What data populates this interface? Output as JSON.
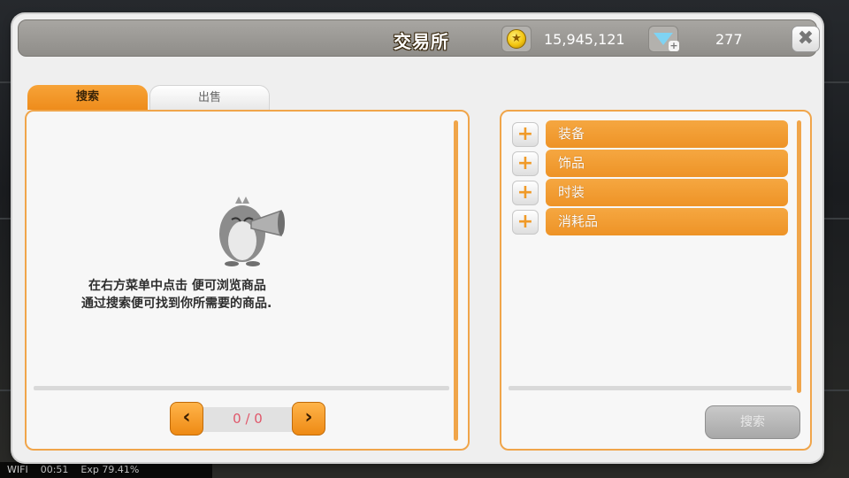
{
  "window": {
    "title": "交易所"
  },
  "currency": {
    "gold_icon": "gold-coin-icon",
    "gold_value": "15,945,121",
    "gem_icon": "gem-plus-icon",
    "gem_value": "277"
  },
  "close_icon": "close-icon",
  "tabs": [
    {
      "label": "搜索",
      "active": true
    },
    {
      "label": "出售",
      "active": false
    }
  ],
  "left_panel": {
    "hint_line1": "在右方菜单中点击 便可浏览商品",
    "hint_line2": "通过搜索便可找到你所需要的商品.",
    "pager_text": "0 / 0",
    "prev_icon": "chevron-left-icon",
    "next_icon": "chevron-right-icon"
  },
  "right_panel": {
    "categories": [
      {
        "label": "装备"
      },
      {
        "label": "饰品"
      },
      {
        "label": "时装"
      },
      {
        "label": "消耗品"
      }
    ],
    "search_button": "搜索"
  },
  "status_bar": {
    "wifi": "WIFI",
    "time": "00:51",
    "exp": "Exp 79.41%"
  },
  "colors": {
    "accent_orange": "#ee9326",
    "panel_border": "#f0a54a",
    "title_bar": "#9a9894",
    "pager_text": "#e0576a"
  }
}
